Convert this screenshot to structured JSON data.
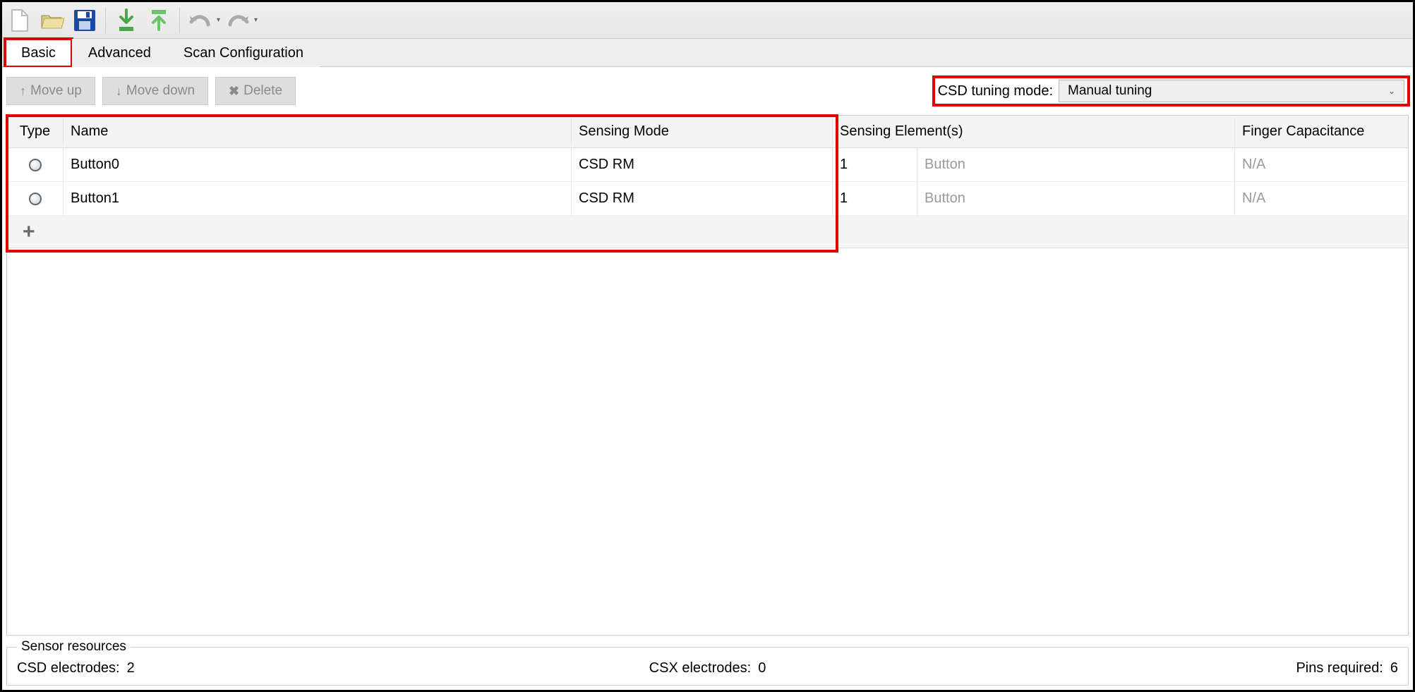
{
  "tabs": {
    "basic": "Basic",
    "advanced": "Advanced",
    "scan": "Scan Configuration"
  },
  "actions": {
    "moveup": "Move up",
    "movedown": "Move down",
    "delete": "Delete"
  },
  "tuning": {
    "label": "CSD tuning mode:",
    "value": "Manual tuning"
  },
  "columns": {
    "type": "Type",
    "name": "Name",
    "mode": "Sensing Mode",
    "elements": "Sensing Element(s)",
    "cap": "Finger Capacitance"
  },
  "rows": [
    {
      "name": "Button0",
      "mode": "CSD RM",
      "elem": "1",
      "elemtype": "Button",
      "cap": "N/A"
    },
    {
      "name": "Button1",
      "mode": "CSD RM",
      "elem": "1",
      "elemtype": "Button",
      "cap": "N/A"
    }
  ],
  "footer": {
    "legend": "Sensor resources",
    "csd_label": "CSD electrodes:",
    "csd_value": "2",
    "csx_label": "CSX electrodes:",
    "csx_value": "0",
    "pins_label": "Pins required:",
    "pins_value": "6"
  }
}
